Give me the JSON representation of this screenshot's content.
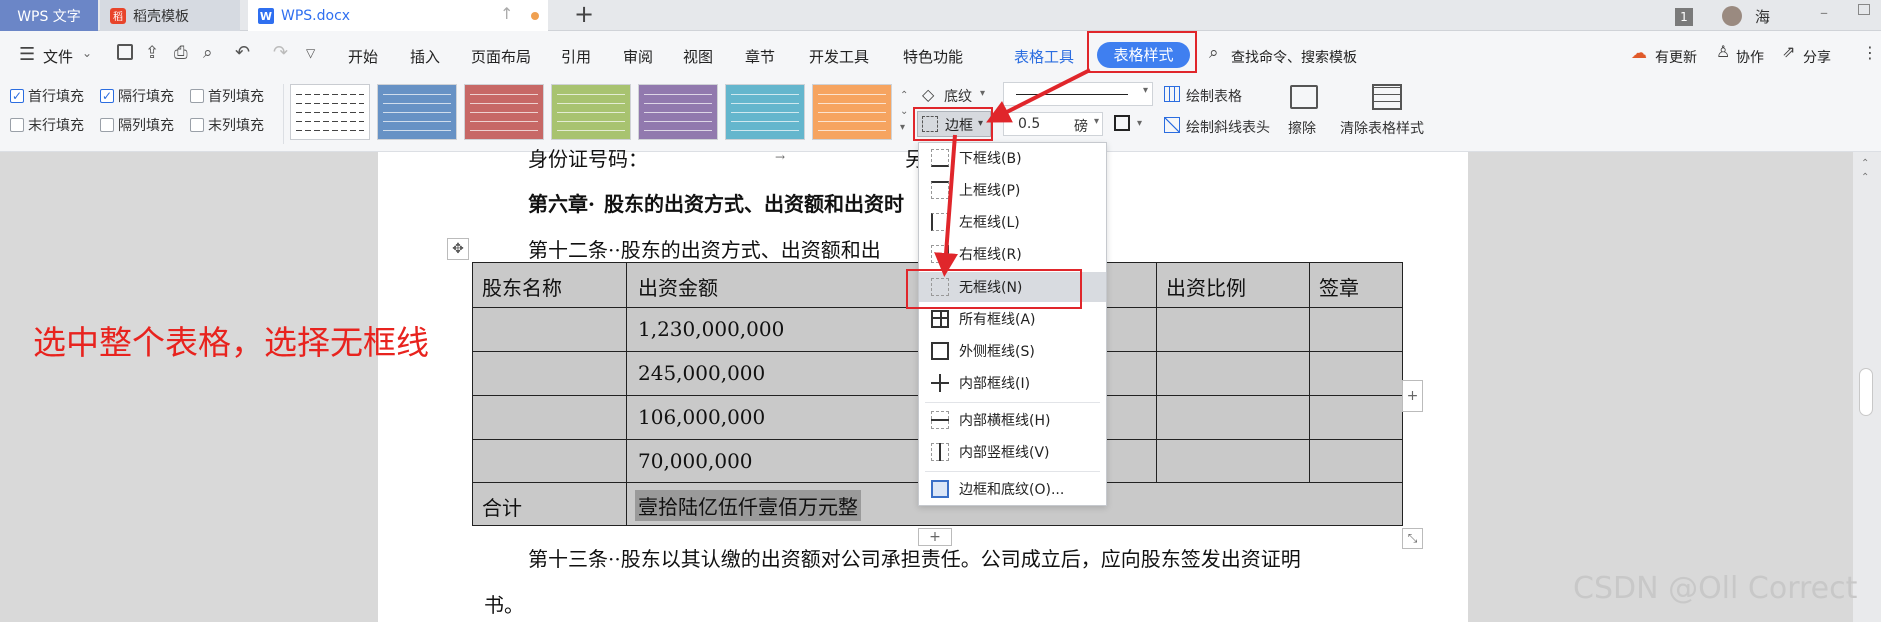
{
  "tabs": {
    "app": "WPS 文字",
    "template": "稻壳模板",
    "doc": "WPS.docx"
  },
  "titlebar": {
    "badge": "1",
    "user": "海"
  },
  "menu": {
    "file": "文件",
    "items": [
      "开始",
      "插入",
      "页面布局",
      "引用",
      "审阅",
      "视图",
      "章节",
      "开发工具",
      "特色功能"
    ],
    "table_tools": "表格工具",
    "table_style": "表格样式",
    "search": "查找命令、搜索模板",
    "update": "有更新",
    "collab": "协作",
    "share": "分享"
  },
  "ribbon": {
    "checks": [
      {
        "label": "首行填充",
        "checked": true
      },
      {
        "label": "隔行填充",
        "checked": true
      },
      {
        "label": "首列填充",
        "checked": false
      },
      {
        "label": "末行填充",
        "checked": false
      },
      {
        "label": "隔列填充",
        "checked": false
      },
      {
        "label": "末列填充",
        "checked": false
      }
    ],
    "shading": "底纹",
    "border": "边框",
    "line_width": "0.5",
    "unit": "磅",
    "draw_table": "绘制表格",
    "draw_diag": "绘制斜线表头",
    "erase": "擦除",
    "clear_style": "清除表格样式"
  },
  "swatch_colors": [
    "#ffffff",
    "#4f81bd",
    "#c0504d",
    "#9bbb59",
    "#8064a2",
    "#4bacc6",
    "#f79646"
  ],
  "document": {
    "line_top": "身份证号码：",
    "heading_a": "第六章·",
    "heading_b": "股东的出资方式、出资额和出资时",
    "art12": "第十二条··股东的出资方式、出资额和出",
    "art13": "第十三条··股东以其认缴的出资额对公司承担责任。公司成立后，应向股东签发出资证明",
    "art13b": "书。",
    "table": {
      "headers": [
        "股东名称",
        "出资金额",
        "出资比例",
        "签章"
      ],
      "amounts": [
        "1,230,000,000",
        "245,000,000",
        "106,000,000",
        "70,000,000"
      ],
      "total_label": "合计",
      "total_value": "壹拾陆亿伍仟壹佰万元整"
    }
  },
  "border_menu": [
    {
      "label": "下框线(B)"
    },
    {
      "label": "上框线(P)"
    },
    {
      "label": "左框线(L)"
    },
    {
      "label": "右框线(R)"
    },
    {
      "label": "无框线(N)"
    },
    {
      "label": "所有框线(A)"
    },
    {
      "label": "外侧框线(S)"
    },
    {
      "label": "内部框线(I)"
    },
    {
      "label": "内部横框线(H)"
    },
    {
      "label": "内部竖框线(V)"
    },
    {
      "label": "边框和底纹(O)..."
    }
  ],
  "annotation": "选中整个表格，选择无框线",
  "watermark": "CSDN @Oll Correct",
  "colors": {
    "accent": "#2b6de0",
    "annotation": "#e8231e"
  }
}
